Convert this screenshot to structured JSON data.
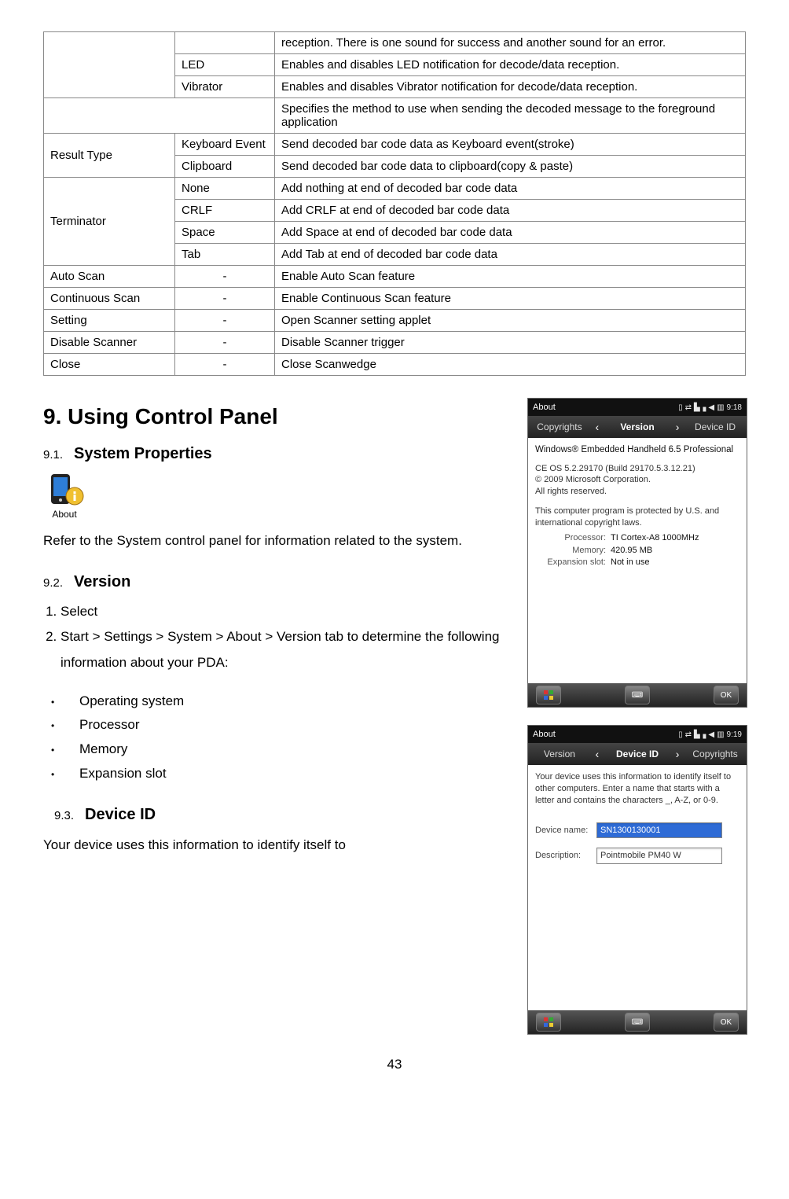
{
  "table": {
    "rows": [
      {
        "c1": "",
        "c2": "",
        "c3": "reception. There is one sound for success and another sound for an error."
      },
      {
        "c2": "LED",
        "c3": "Enables and disables LED notification for decode/data reception."
      },
      {
        "c2": "Vibrator",
        "c3": "Enables and disables Vibrator notification for decode/data reception."
      },
      {
        "c3": "Specifies the method to use when sending the decoded message to the foreground application"
      },
      {
        "c1": "Result Type",
        "c2": "Keyboard Event",
        "c3": "Send decoded bar code data as Keyboard event(stroke)"
      },
      {
        "c2": "Clipboard",
        "c3": "Send decoded bar code data to clipboard(copy & paste)"
      },
      {
        "c1": "Terminator",
        "c2": "None",
        "c3": "Add nothing at end of decoded bar code data"
      },
      {
        "c2": "CRLF",
        "c3": "Add CRLF at end of decoded bar code data"
      },
      {
        "c2": "Space",
        "c3": "Add Space at end of decoded bar code data"
      },
      {
        "c2": "Tab",
        "c3": "Add Tab at end of decoded bar code data"
      },
      {
        "c1": "Auto Scan",
        "c2": "-",
        "c3": "Enable Auto Scan feature"
      },
      {
        "c1": "Continuous Scan",
        "c2": "-",
        "c3": "Enable Continuous Scan feature"
      },
      {
        "c1": "Setting",
        "c2": "-",
        "c3": "Open Scanner setting applet"
      },
      {
        "c1": "Disable Scanner",
        "c2": "-",
        "c3": "Disable Scanner trigger"
      },
      {
        "c1": "Close",
        "c2": "-",
        "c3": "Close Scanwedge"
      }
    ]
  },
  "sections": {
    "h1": "9.  Using Control Panel",
    "s1_num": "9.1.",
    "s1_title": "System Properties",
    "about_label": "About",
    "s1_body": "Refer to the System control panel for information related to the system.",
    "s2_num": "9.2.",
    "s2_title": "Version",
    "s2_list_1": "Select",
    "s2_list_2": "Start > Settings > System > About > Version tab to determine the following information about your PDA:",
    "s2_bullets": [
      "Operating system",
      "Processor",
      "Memory",
      "Expansion slot"
    ],
    "s3_num": "9.3.",
    "s3_title": "Device ID",
    "s3_body": "Your device uses this information to identify itself to"
  },
  "mock1": {
    "title": "About",
    "time": "9:18",
    "tab_left": "Copyrights",
    "tab_center": "Version",
    "tab_right": "Device ID",
    "headline": "Windows® Embedded Handheld 6.5 Professional",
    "lines": [
      "CE OS 5.2.29170 (Build 29170.5.3.12.21)",
      "© 2009 Microsoft Corporation.",
      "All rights reserved."
    ],
    "para": "This computer program is protected by U.S. and international copyright laws.",
    "specs": [
      {
        "k": "Processor:",
        "v": "TI Cortex-A8 1000MHz"
      },
      {
        "k": "Memory:",
        "v": "420.95 MB"
      },
      {
        "k": "Expansion slot:",
        "v": "Not in use"
      }
    ],
    "ok": "OK"
  },
  "mock2": {
    "title": "About",
    "time": "9:19",
    "tab_left": "Version",
    "tab_center": "Device ID",
    "tab_right": "Copyrights",
    "para": "Your device uses this information to identify itself to other computers. Enter a name that starts with a letter and contains the characters _, A-Z, or 0-9.",
    "device_label": "Device name:",
    "device_value": "SN1300130001",
    "desc_label": "Description:",
    "desc_value": "Pointmobile PM40 W",
    "ok": "OK"
  },
  "page": "43"
}
